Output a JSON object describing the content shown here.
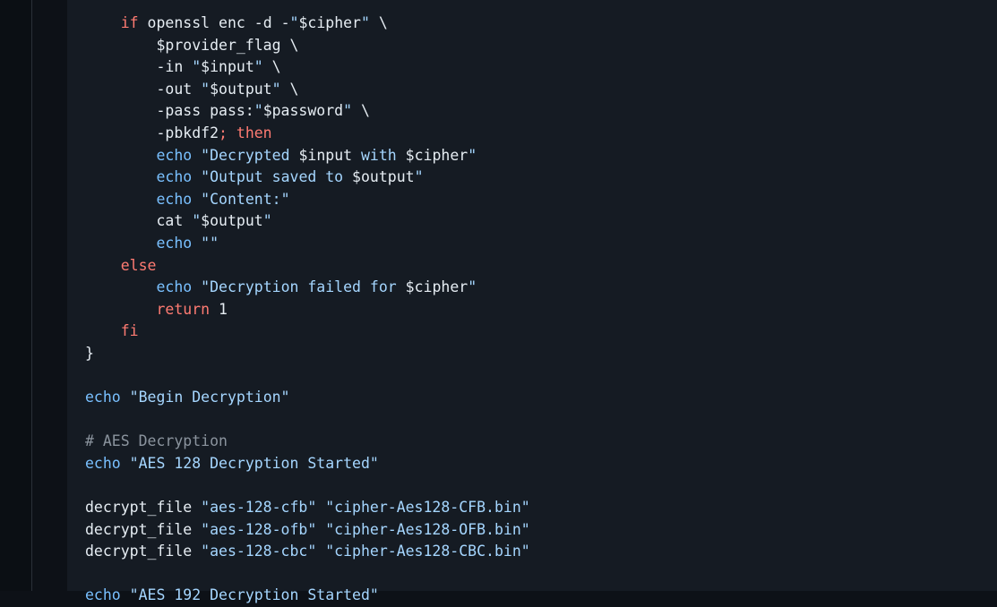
{
  "editor": {
    "lines": [
      [
        {
          "t": "    ",
          "c": "plain"
        },
        {
          "t": "if",
          "c": "kw"
        },
        {
          "t": " openssl enc -d -",
          "c": "plain"
        },
        {
          "t": "\"",
          "c": "str"
        },
        {
          "t": "$cipher",
          "c": "var"
        },
        {
          "t": "\"",
          "c": "str"
        },
        {
          "t": " \\",
          "c": "plain"
        }
      ],
      [
        {
          "t": "        $provider_flag \\",
          "c": "plain"
        }
      ],
      [
        {
          "t": "        -in ",
          "c": "plain"
        },
        {
          "t": "\"",
          "c": "str"
        },
        {
          "t": "$input",
          "c": "var"
        },
        {
          "t": "\"",
          "c": "str"
        },
        {
          "t": " \\",
          "c": "plain"
        }
      ],
      [
        {
          "t": "        -out ",
          "c": "plain"
        },
        {
          "t": "\"",
          "c": "str"
        },
        {
          "t": "$output",
          "c": "var"
        },
        {
          "t": "\"",
          "c": "str"
        },
        {
          "t": " \\",
          "c": "plain"
        }
      ],
      [
        {
          "t": "        -pass pass:",
          "c": "plain"
        },
        {
          "t": "\"",
          "c": "str"
        },
        {
          "t": "$password",
          "c": "var"
        },
        {
          "t": "\"",
          "c": "str"
        },
        {
          "t": " \\",
          "c": "plain"
        }
      ],
      [
        {
          "t": "        -pbkdf2",
          "c": "plain"
        },
        {
          "t": "; then",
          "c": "kw"
        }
      ],
      [
        {
          "t": "        ",
          "c": "plain"
        },
        {
          "t": "echo",
          "c": "bi"
        },
        {
          "t": " \"Decrypted ",
          "c": "str"
        },
        {
          "t": "$input",
          "c": "var"
        },
        {
          "t": " with ",
          "c": "str"
        },
        {
          "t": "$cipher",
          "c": "var"
        },
        {
          "t": "\"",
          "c": "str"
        }
      ],
      [
        {
          "t": "        ",
          "c": "plain"
        },
        {
          "t": "echo",
          "c": "bi"
        },
        {
          "t": " \"Output saved to ",
          "c": "str"
        },
        {
          "t": "$output",
          "c": "var"
        },
        {
          "t": "\"",
          "c": "str"
        }
      ],
      [
        {
          "t": "        ",
          "c": "plain"
        },
        {
          "t": "echo",
          "c": "bi"
        },
        {
          "t": " \"Content:\"",
          "c": "str"
        }
      ],
      [
        {
          "t": "        cat ",
          "c": "plain"
        },
        {
          "t": "\"",
          "c": "str"
        },
        {
          "t": "$output",
          "c": "var"
        },
        {
          "t": "\"",
          "c": "str"
        }
      ],
      [
        {
          "t": "        ",
          "c": "plain"
        },
        {
          "t": "echo",
          "c": "bi"
        },
        {
          "t": " \"\"",
          "c": "str"
        }
      ],
      [
        {
          "t": "    ",
          "c": "plain"
        },
        {
          "t": "else",
          "c": "kw"
        }
      ],
      [
        {
          "t": "        ",
          "c": "plain"
        },
        {
          "t": "echo",
          "c": "bi"
        },
        {
          "t": " \"Decryption failed for ",
          "c": "str"
        },
        {
          "t": "$cipher",
          "c": "var"
        },
        {
          "t": "\"",
          "c": "str"
        }
      ],
      [
        {
          "t": "        ",
          "c": "plain"
        },
        {
          "t": "return",
          "c": "kw"
        },
        {
          "t": " 1",
          "c": "plain"
        }
      ],
      [
        {
          "t": "    ",
          "c": "plain"
        },
        {
          "t": "fi",
          "c": "kw"
        }
      ],
      [
        {
          "t": "}",
          "c": "plain"
        }
      ],
      [],
      [
        {
          "t": "echo",
          "c": "bi"
        },
        {
          "t": " \"Begin Decryption\"",
          "c": "str"
        }
      ],
      [],
      [
        {
          "t": "# AES Decryption",
          "c": "cmt"
        }
      ],
      [
        {
          "t": "echo",
          "c": "bi"
        },
        {
          "t": " \"AES 128 Decryption Started\"",
          "c": "str"
        }
      ],
      [],
      [
        {
          "t": "decrypt_file ",
          "c": "plain"
        },
        {
          "t": "\"aes-128-cfb\"",
          "c": "str"
        },
        {
          "t": " ",
          "c": "plain"
        },
        {
          "t": "\"cipher-Aes128-CFB.bin\"",
          "c": "str"
        }
      ],
      [
        {
          "t": "decrypt_file ",
          "c": "plain"
        },
        {
          "t": "\"aes-128-ofb\"",
          "c": "str"
        },
        {
          "t": " ",
          "c": "plain"
        },
        {
          "t": "\"cipher-Aes128-OFB.bin\"",
          "c": "str"
        }
      ],
      [
        {
          "t": "decrypt_file ",
          "c": "plain"
        },
        {
          "t": "\"aes-128-cbc\"",
          "c": "str"
        },
        {
          "t": " ",
          "c": "plain"
        },
        {
          "t": "\"cipher-Aes128-CBC.bin\"",
          "c": "str"
        }
      ],
      [],
      [
        {
          "t": "echo",
          "c": "bi"
        },
        {
          "t": " \"AES 192 Decryption Started\"",
          "c": "str"
        }
      ]
    ]
  }
}
